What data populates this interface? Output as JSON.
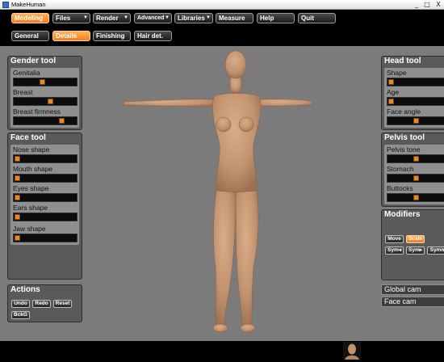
{
  "window": {
    "title": "MakeHuman",
    "minimize": "_",
    "maximize": "□",
    "close": "X"
  },
  "menu": {
    "tabs": [
      {
        "label": "Modeling",
        "active": true
      },
      {
        "label": "Files",
        "arrow": "▼"
      },
      {
        "label": "Render",
        "arrow": "▼"
      },
      {
        "label": "Advanced",
        "arrow": "▼"
      },
      {
        "label": "Libraries",
        "arrow": "▼"
      },
      {
        "label": "Measure"
      },
      {
        "label": "Help"
      },
      {
        "label": "Quit"
      }
    ]
  },
  "subtabs": [
    {
      "label": "General"
    },
    {
      "label": "Details",
      "active": true
    },
    {
      "label": "Finishing"
    },
    {
      "label": "Hair det."
    }
  ],
  "gender_tool": {
    "title": "Gender tool",
    "sliders": [
      {
        "label": "Genitalia",
        "value": 0.45
      },
      {
        "label": "Breast",
        "value": 0.6
      },
      {
        "label": "Breast firmness",
        "value": 0.8
      }
    ]
  },
  "face_tool": {
    "title": "Face tool",
    "sliders": [
      {
        "label": "Nose shape",
        "value": 0.0
      },
      {
        "label": "Mouth shape",
        "value": 0.0
      },
      {
        "label": "Eyes shape",
        "value": 0.0
      },
      {
        "label": "Ears shape",
        "value": 0.0
      },
      {
        "label": "Jaw shape",
        "value": 0.0
      }
    ]
  },
  "actions": {
    "title": "Actions",
    "buttons": [
      "Undo",
      "Redo",
      "Reset",
      "BckG"
    ]
  },
  "head_tool": {
    "title": "Head tool",
    "sliders": [
      {
        "label": "Shape",
        "value": 0.0
      },
      {
        "label": "Age",
        "value": 0.0
      },
      {
        "label": "Face angle",
        "value": 0.45
      }
    ]
  },
  "pelvis_tool": {
    "title": "Pelvis tool",
    "sliders": [
      {
        "label": "Pelvis tone",
        "value": 0.45
      },
      {
        "label": "Stomach",
        "value": 0.45
      },
      {
        "label": "Buttocks",
        "value": 0.45
      }
    ]
  },
  "modifiers": {
    "title": "Modifiers",
    "row1": [
      {
        "label": "Move"
      },
      {
        "label": "Scale",
        "active": true
      }
    ],
    "row2": [
      {
        "label": "Sym◂"
      },
      {
        "label": "Sym▸"
      },
      {
        "label": "Symm"
      }
    ]
  },
  "cameras": {
    "global": "Global cam",
    "face": "Face cam"
  },
  "colors": {
    "accent": "#f08a2a",
    "background": "#7b7b7b",
    "panel": "#5a5a5a",
    "skin": "#c99b78"
  }
}
